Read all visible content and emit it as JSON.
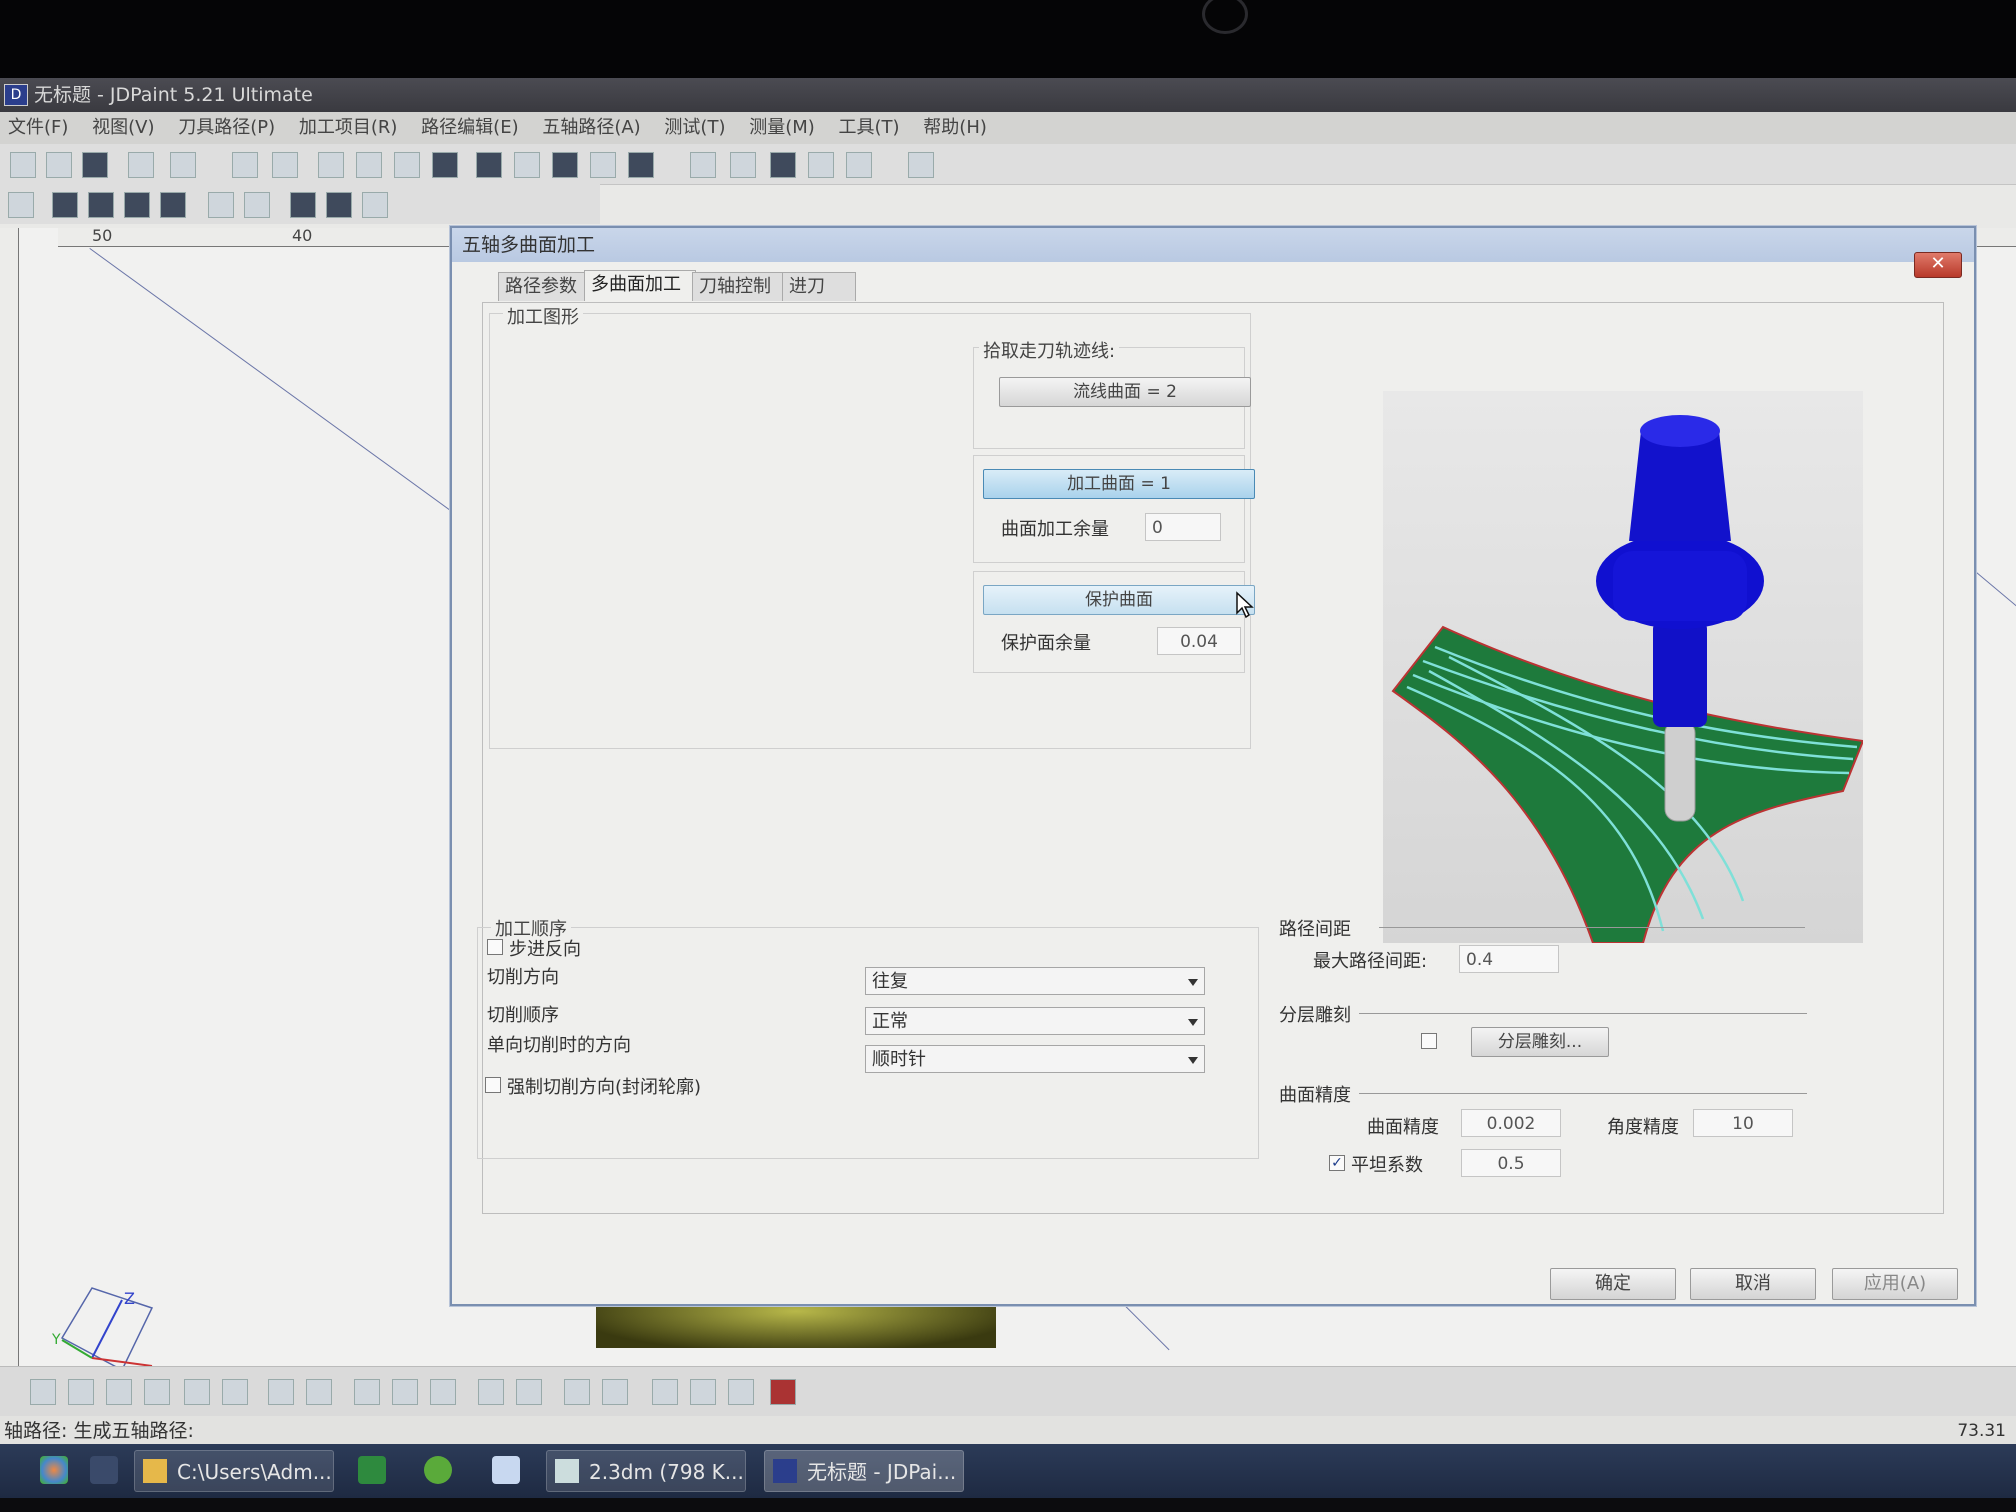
{
  "window": {
    "title": "无标题 - JDPaint 5.21 Ultimate",
    "app_icon_label": "D"
  },
  "menu": [
    "文件(F)",
    "视图(V)",
    "刀具路径(P)",
    "加工项目(R)",
    "路径编辑(E)",
    "五轴路径(A)",
    "测试(T)",
    "测量(M)",
    "工具(T)",
    "帮助(H)"
  ],
  "ruler": {
    "mark1": "50",
    "mark2": "40"
  },
  "dialog": {
    "title": "五轴多曲面加工",
    "close_label": "✕",
    "tabs": [
      "路径参数",
      "多曲面加工",
      "刀轴控制",
      "进刀"
    ],
    "active_tab": 1,
    "group_shape": "加工图形",
    "pick_label": "拾取走刀轨迹线:",
    "streamline_btn": "流线曲面 = 2",
    "machine_surface_btn": "加工曲面 = 1",
    "surface_allowance_label": "曲面加工余量",
    "surface_allowance_value": "0",
    "protect_surface_btn": "保护曲面",
    "protect_allowance_label": "保护面余量",
    "protect_allowance_value": "0.04",
    "order_group": "加工顺序",
    "step_reverse_label": "步进反向",
    "step_reverse_checked": false,
    "cut_direction_label": "切削方向",
    "cut_direction_value": "往复",
    "cut_order_label": "切削顺序",
    "cut_order_value": "正常",
    "one_way_dir_label": "单向切削时的方向",
    "one_way_dir_value": "顺时针",
    "force_dir_label": "强制切削方向(封闭轮廓)",
    "force_dir_checked": false,
    "path_spacing_group": "路径间距",
    "max_spacing_label": "最大路径间距:",
    "max_spacing_value": "0.4",
    "layer_group": "分层雕刻",
    "layer_checked": false,
    "layer_btn": "分层雕刻...",
    "precision_group": "曲面精度",
    "surface_precision_label": "曲面精度",
    "surface_precision_value": "0.002",
    "angle_precision_label": "角度精度",
    "angle_precision_value": "10",
    "flat_factor_label": "平坦系数",
    "flat_factor_checked": true,
    "flat_factor_value": "0.5",
    "ok_btn": "确定",
    "cancel_btn": "取消",
    "apply_btn": "应用(A)"
  },
  "status": {
    "text": "轴路径: 生成五轴路径:",
    "coord": "73.31"
  },
  "taskbar": {
    "items": [
      "C:\\Users\\Adm...",
      "2.3dm (798 K...",
      "无标题 - JDPai..."
    ]
  },
  "colors": {
    "tool_blue": "#1010d0",
    "surface_green": "#1e7a3c",
    "toolpath_cyan": "#7fe0d8",
    "dialog_title": "#c4d3e8"
  }
}
